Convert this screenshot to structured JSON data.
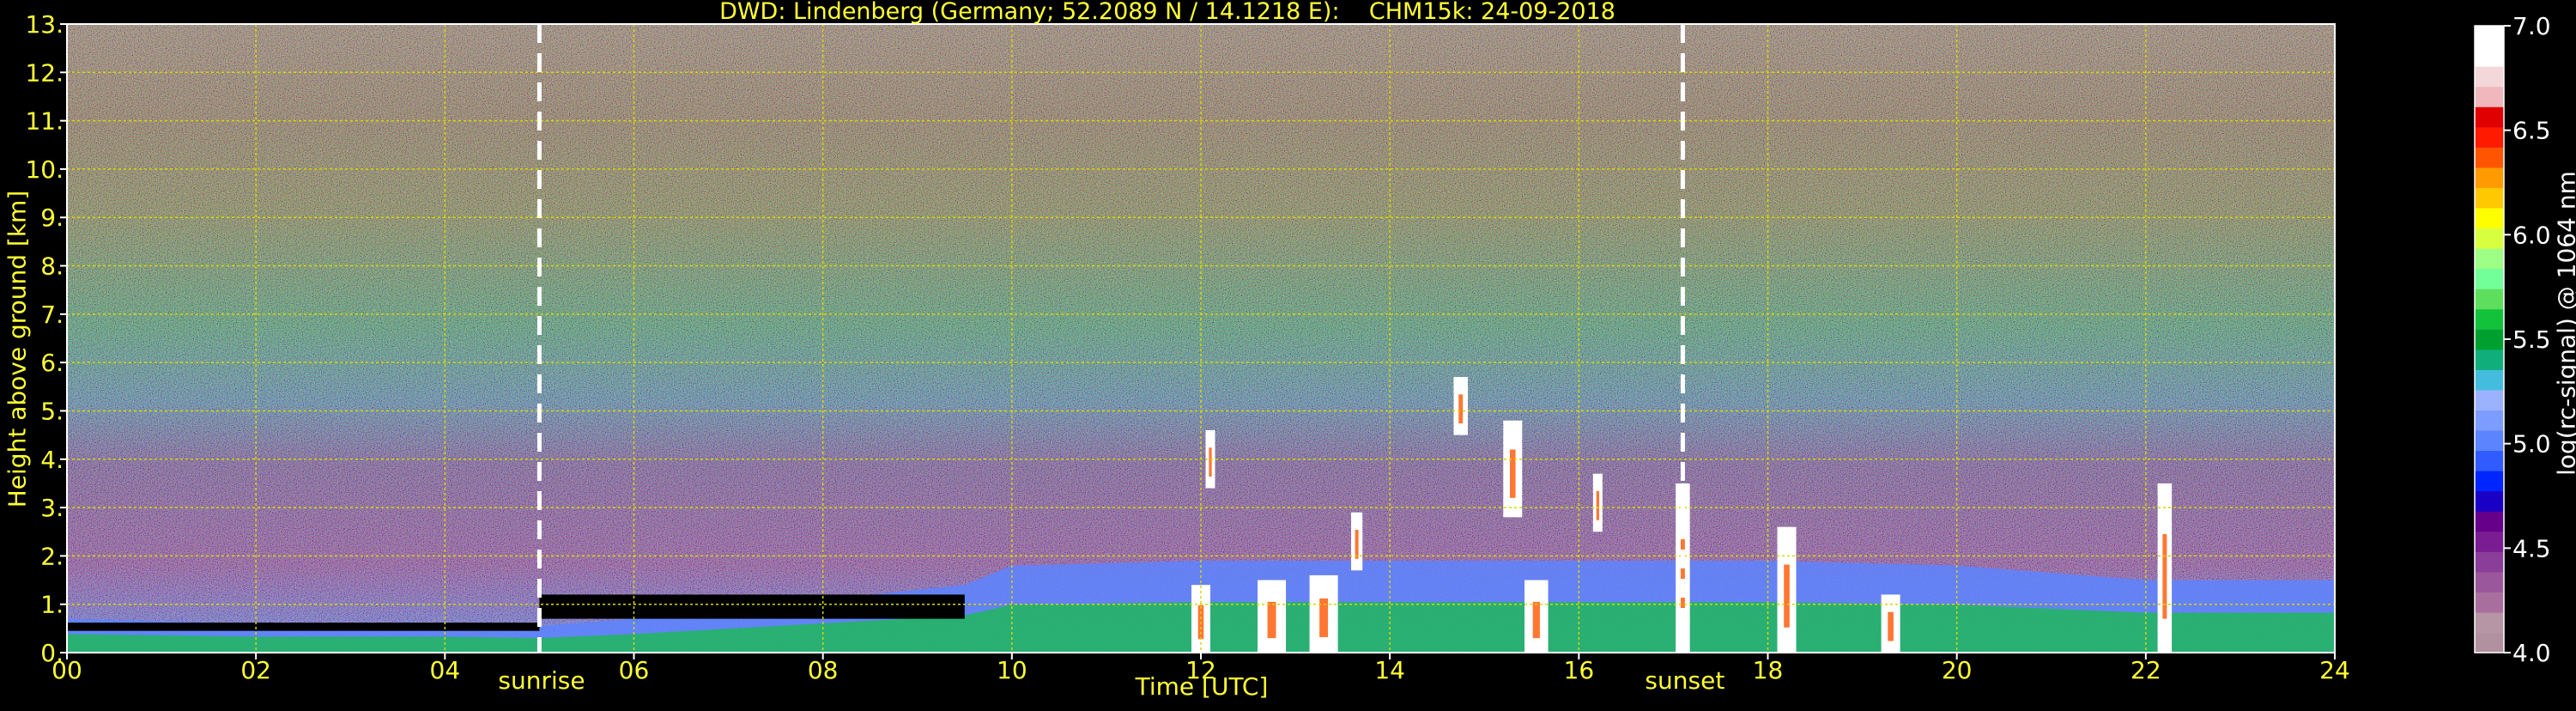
{
  "chart_data": {
    "type": "heatmap",
    "title": "DWD: Lindenberg (Germany; 52.2089 N / 14.1218 E):    CHM15k: 24-09-2018",
    "xlabel": "Time [UTC]",
    "ylabel": "Height above ground [km]",
    "xlim": [
      0,
      24
    ],
    "ylim": [
      0,
      13
    ],
    "x_ticks": [
      {
        "value": 0,
        "label": "00"
      },
      {
        "value": 2,
        "label": "02"
      },
      {
        "value": 4,
        "label": "04"
      },
      {
        "value": 6,
        "label": "06"
      },
      {
        "value": 8,
        "label": "08"
      },
      {
        "value": 10,
        "label": "10"
      },
      {
        "value": 12,
        "label": "12"
      },
      {
        "value": 14,
        "label": "14"
      },
      {
        "value": 16,
        "label": "16"
      },
      {
        "value": 18,
        "label": "18"
      },
      {
        "value": 20,
        "label": "20"
      },
      {
        "value": 22,
        "label": "22"
      },
      {
        "value": 24,
        "label": "24"
      }
    ],
    "y_ticks": [
      {
        "value": 0,
        "label": "0."
      },
      {
        "value": 1,
        "label": "1."
      },
      {
        "value": 2,
        "label": "2."
      },
      {
        "value": 3,
        "label": "3."
      },
      {
        "value": 4,
        "label": "4."
      },
      {
        "value": 5,
        "label": "5."
      },
      {
        "value": 6,
        "label": "6."
      },
      {
        "value": 7,
        "label": "7."
      },
      {
        "value": 8,
        "label": "8."
      },
      {
        "value": 9,
        "label": "9."
      },
      {
        "value": 10,
        "label": "10."
      },
      {
        "value": 11,
        "label": "11."
      },
      {
        "value": 12,
        "label": "12."
      },
      {
        "value": 13,
        "label": "13."
      }
    ],
    "grid": true,
    "grid_color": "#d7d700",
    "events": [
      {
        "name": "sunrise",
        "time": 5.0
      },
      {
        "name": "sunset",
        "time": 17.1
      }
    ],
    "colorbar": {
      "label": "log(rc-signal) @ 1064 nm",
      "range": [
        4.0,
        7.0
      ],
      "ticks": [
        {
          "value": 4.0,
          "label": "4.0"
        },
        {
          "value": 4.5,
          "label": "4.5"
        },
        {
          "value": 5.0,
          "label": "5.0"
        },
        {
          "value": 5.5,
          "label": "5.5"
        },
        {
          "value": 6.0,
          "label": "6.0"
        },
        {
          "value": 6.5,
          "label": "6.5"
        },
        {
          "value": 7.0,
          "label": "7.0"
        }
      ],
      "colors": [
        "#b1909f",
        "#b695a4",
        "#a86f9e",
        "#9a579c",
        "#8a3e99",
        "#7a1d93",
        "#66008a",
        "#1a00c4",
        "#0025ff",
        "#2f5bff",
        "#5d84ff",
        "#7d9cff",
        "#9bb2ff",
        "#44bcdd",
        "#0fae7a",
        "#00a030",
        "#12c23a",
        "#5dde5d",
        "#72ff9a",
        "#9dff86",
        "#d8ff3f",
        "#ffff00",
        "#ffc800",
        "#ff9a00",
        "#ff5500",
        "#ff1a00",
        "#e00000",
        "#f0b7bc",
        "#f4d7d9",
        "#ffffff",
        "#ffffff"
      ]
    },
    "cloud_base_layers": [
      {
        "t0": 0.0,
        "t1": 5.0,
        "base": 0.45,
        "top": 0.62,
        "color": "#000000"
      },
      {
        "t0": 5.0,
        "t1": 9.5,
        "base": 0.7,
        "top": 1.2,
        "color": "#000000"
      }
    ],
    "boundary_layer": [
      {
        "time": 0,
        "top": 0.7
      },
      {
        "time": 2,
        "top": 0.6
      },
      {
        "time": 4,
        "top": 0.6
      },
      {
        "time": 5,
        "top": 0.55
      },
      {
        "time": 6,
        "top": 0.7
      },
      {
        "time": 8,
        "top": 1.1
      },
      {
        "time": 9.5,
        "top": 1.4
      },
      {
        "time": 10,
        "top": 1.8
      },
      {
        "time": 12,
        "top": 1.9
      },
      {
        "time": 14,
        "top": 1.9
      },
      {
        "time": 16,
        "top": 1.9
      },
      {
        "time": 18,
        "top": 1.9
      },
      {
        "time": 20,
        "top": 1.8
      },
      {
        "time": 22,
        "top": 1.5
      },
      {
        "time": 24,
        "top": 1.5
      }
    ],
    "clouds": [
      {
        "time": 12.0,
        "width": 0.2,
        "base": 0.0,
        "top": 1.4
      },
      {
        "time": 12.1,
        "width": 0.1,
        "base": 3.4,
        "top": 4.6
      },
      {
        "time": 12.75,
        "width": 0.3,
        "base": 0.0,
        "top": 1.5
      },
      {
        "time": 13.3,
        "width": 0.3,
        "base": 0.0,
        "top": 1.6
      },
      {
        "time": 13.65,
        "width": 0.12,
        "base": 1.7,
        "top": 2.9
      },
      {
        "time": 14.75,
        "width": 0.15,
        "base": 4.5,
        "top": 5.7
      },
      {
        "time": 15.3,
        "width": 0.2,
        "base": 2.8,
        "top": 4.8
      },
      {
        "time": 15.55,
        "width": 0.25,
        "base": 0.0,
        "top": 1.5
      },
      {
        "time": 16.2,
        "width": 0.1,
        "base": 2.5,
        "top": 3.7
      },
      {
        "time": 17.1,
        "width": 0.15,
        "base": 0.0,
        "top": 3.5
      },
      {
        "time": 18.2,
        "width": 0.2,
        "base": 0.0,
        "top": 2.6
      },
      {
        "time": 19.3,
        "width": 0.2,
        "base": 0.0,
        "top": 1.2
      },
      {
        "time": 22.2,
        "width": 0.15,
        "base": 0.0,
        "top": 3.5
      }
    ]
  }
}
